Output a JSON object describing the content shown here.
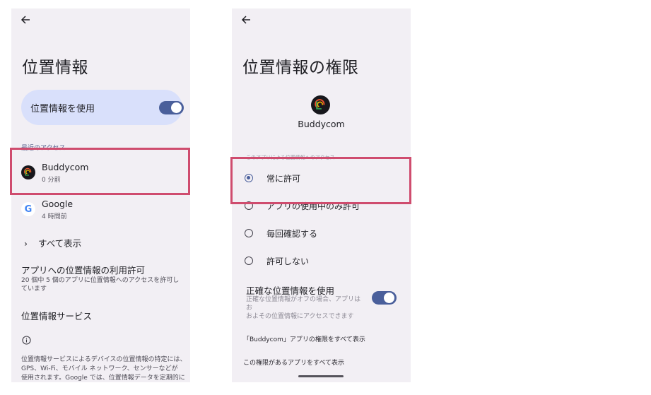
{
  "left": {
    "title": "位置情報",
    "toggle": {
      "label": "位置情報を使用",
      "on": true
    },
    "recent_label": "最近のアクセス",
    "recent_apps": [
      {
        "name": "Buddycom",
        "time": "0 分前",
        "icon": "buddycom-app-icon"
      },
      {
        "name": "Google",
        "time": "4 時間前",
        "icon": "google-g-icon"
      }
    ],
    "show_all": "すべて表示",
    "app_permission": {
      "heading": "アプリへの位置情報の利用許可",
      "line1": "20 個中 5 個のアプリに位置情報へのアクセスを許可し",
      "line2": "ています"
    },
    "services_heading": "位置情報サービス",
    "footer": {
      "line1": "位置情報サービスによるデバイスの位置情報の特定には、",
      "line2": "GPS、Wi-Fi、モバイル ネットワーク、センサーなどが",
      "line3": "使用されます。Google では、位置情報データを定期的に"
    }
  },
  "right": {
    "title": "位置情報の権限",
    "app_name": "Buddycom",
    "faded_label": "このアプリによる位置情報へのアクセス",
    "options": [
      {
        "label": "常に許可",
        "selected": true
      },
      {
        "label": "アプリの使用中のみ許可",
        "selected": false
      },
      {
        "label": "毎回確認する",
        "selected": false
      },
      {
        "label": "許可しない",
        "selected": false
      }
    ],
    "precise": {
      "title": "正確な位置情報を使用",
      "desc1": "正確な位置情報がオフの場合、アプリはお",
      "desc2": "およその位置情報にアクセスできます",
      "on": true
    },
    "link_all_permissions": "「Buddycom」アプリの権限をすべて表示",
    "link_apps_with_permission": "この権限があるアプリをすべて表示"
  },
  "colors": {
    "highlight": "#cf4c6e",
    "accent": "#4a5f9b",
    "toggle_card": "#d9e0fb",
    "screen_bg": "#f2eff4"
  }
}
